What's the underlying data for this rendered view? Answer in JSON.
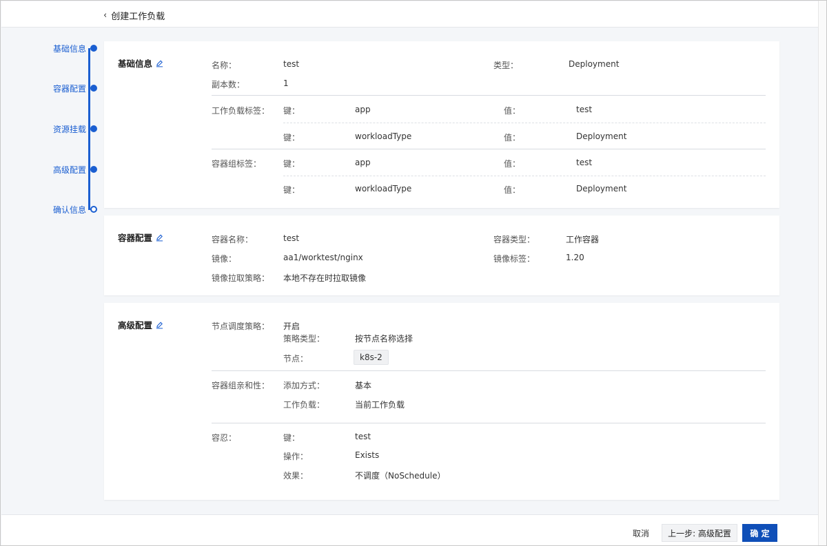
{
  "header": {
    "back_label": "创建工作负载"
  },
  "stepper": {
    "steps": [
      {
        "label": "基础信息"
      },
      {
        "label": "容器配置"
      },
      {
        "label": "资源挂载"
      },
      {
        "label": "高级配置"
      },
      {
        "label": "确认信息"
      }
    ]
  },
  "basic": {
    "title": "基础信息",
    "name_label": "名称：",
    "name_value": "test",
    "type_label": "类型：",
    "type_value": "Deployment",
    "replicas_label": "副本数：",
    "replicas_value": "1",
    "workload_labels_label": "工作负载标签：",
    "pod_labels_label": "容器组标签：",
    "key_label": "键：",
    "value_label": "值：",
    "workload_labels": [
      {
        "key": "app",
        "value": "test"
      },
      {
        "key": "workloadType",
        "value": "Deployment"
      }
    ],
    "pod_labels": [
      {
        "key": "app",
        "value": "test"
      },
      {
        "key": "workloadType",
        "value": "Deployment"
      }
    ]
  },
  "container": {
    "title": "容器配置",
    "name_label": "容器名称：",
    "name_value": "test",
    "type_label": "容器类型：",
    "type_value": "工作容器",
    "image_label": "镜像：",
    "image_value": "aa1/worktest/nginx",
    "tag_label": "镜像标签：",
    "tag_value": "1.20",
    "pull_label": "镜像拉取策略：",
    "pull_value": "本地不存在时拉取镜像"
  },
  "advanced": {
    "title": "高级配置",
    "node_sched_label": "节点调度策略：",
    "node_sched_value": "开启",
    "policy_type_label": "策略类型：",
    "policy_type_value": "按节点名称选择",
    "node_label": "节点：",
    "node_value": "k8s-2",
    "affinity_label": "容器组亲和性：",
    "add_mode_label": "添加方式：",
    "add_mode_value": "基本",
    "workload_label": "工作负载：",
    "workload_value": "当前工作负载",
    "toleration_label": "容忍：",
    "tol_key_label": "键：",
    "tol_key_value": "test",
    "tol_op_label": "操作：",
    "tol_op_value": "Exists",
    "tol_effect_label": "效果：",
    "tol_effect_value": "不调度（NoSchedule）"
  },
  "footer": {
    "cancel_label": "取消",
    "prev_label": "上一步: 高级配置",
    "confirm_label": "确 定"
  },
  "colors": {
    "accent": "#1a5ed1",
    "primary_button": "#0f4fb8"
  }
}
